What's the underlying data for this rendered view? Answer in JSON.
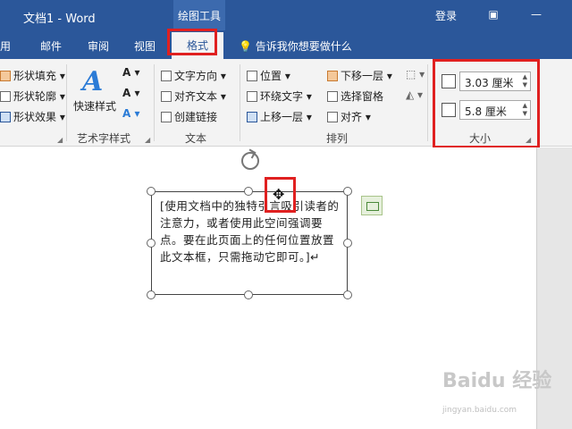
{
  "titlebar": {
    "doc_title": "文档1  -  Word",
    "context_tab": "绘图工具",
    "login": "登录",
    "restore_icon": "ribbon-display-icon",
    "minimize_icon": "minimize-icon"
  },
  "tabs": {
    "items": [
      "用",
      "邮件",
      "审阅",
      "视图",
      "格式"
    ],
    "active": "格式",
    "tell_me": "告诉我你想要做什么"
  },
  "ribbon": {
    "shape_styles": {
      "fill": "形状填充",
      "outline": "形状轮廓",
      "effects": "形状效果"
    },
    "art_styles": {
      "label": "艺术字样式",
      "quick_styles": "快速样式"
    },
    "text": {
      "label": "文本",
      "direction": "文字方向",
      "align": "对齐文本",
      "link": "创建链接"
    },
    "arrange": {
      "label": "排列",
      "position": "位置",
      "wrap": "环绕文字",
      "bring_forward": "上移一层",
      "send_backward": "下移一层",
      "selection_pane": "选择窗格",
      "align": "对齐"
    },
    "size": {
      "label": "大小",
      "height": "3.03 厘米",
      "width": "5.8 厘米"
    }
  },
  "document": {
    "textbox_text": "[使用文档中的独特引言吸引读者的注意力，或者使用此空间强调要点。要在此页面上的任何位置放置此文本框，只需拖动它即可。]↵"
  },
  "watermark": {
    "main": "Baidu 经验",
    "sub": "jingyan.baidu.com"
  },
  "colors": {
    "accent": "#2b579a",
    "highlight": "#e02020"
  }
}
